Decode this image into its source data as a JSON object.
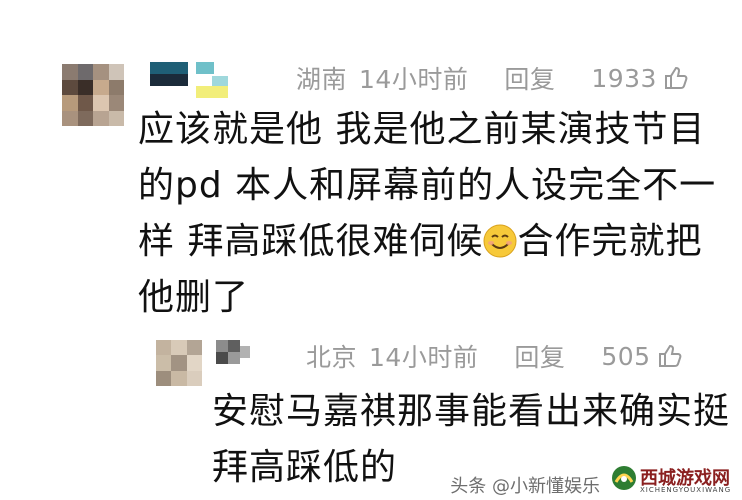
{
  "comments": [
    {
      "location": "湖南",
      "time": "14小时前",
      "reply_label": "回复",
      "likes": "1933",
      "text_lines": [
        "应该就是他 我是他之前某演技节目",
        "的pd 本人和屏幕前的人设完全不一",
        "样 拜高踩低很难伺候",
        "他删了"
      ],
      "line3_after_emoji": "合作完就把",
      "emoji": "smile-emoji"
    },
    {
      "location": "北京",
      "time": "14小时前",
      "reply_label": "回复",
      "likes": "505",
      "text_lines": [
        "安慰马嘉祺那事能看出来确实挺",
        "拜高踩低的"
      ]
    }
  ],
  "watermark": {
    "source": "头条 @小新懂娱乐",
    "logo_text": "西城游戏网",
    "logo_sub": "XICHENGYOUXIWANG"
  },
  "colors": {
    "meta_gray": "#9a9a9a",
    "text": "#111111"
  }
}
